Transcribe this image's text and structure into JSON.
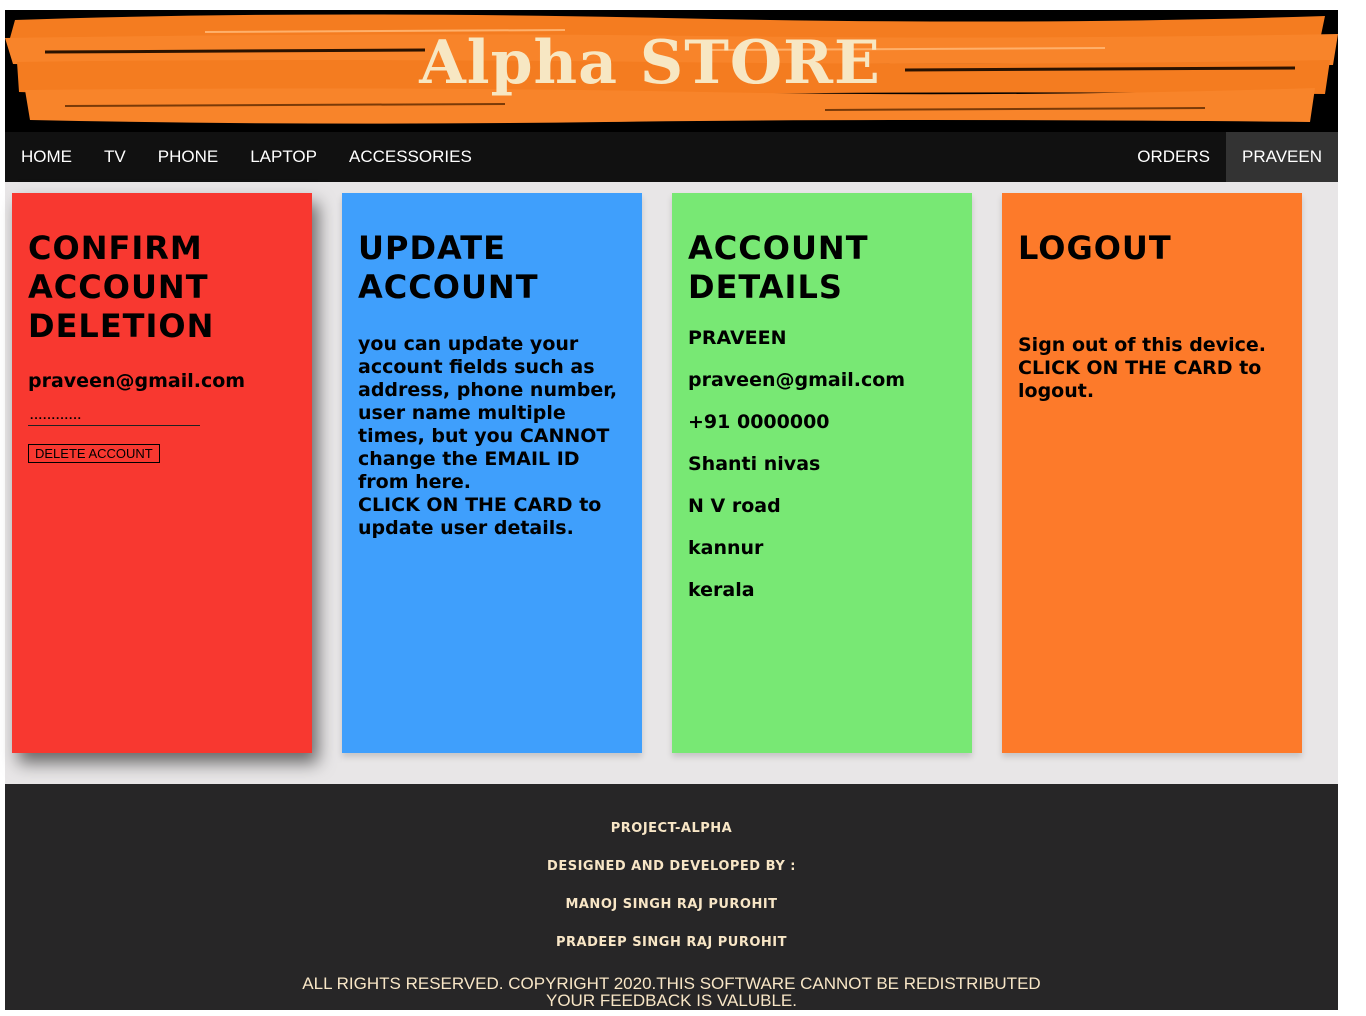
{
  "brand": {
    "title": "Alpha STORE"
  },
  "nav": {
    "items": [
      "HOME",
      "TV",
      "PHONE",
      "LAPTOP",
      "ACCESSORIES"
    ],
    "orders": "ORDERS",
    "user": "PRAVEEN"
  },
  "delete_card": {
    "title": "CONFIRM ACCOUNT DELETION",
    "email": "praveen@gmail.com",
    "password_value": "............",
    "button": "DELETE ACCOUNT",
    "color": "#f83830"
  },
  "update_card": {
    "title": "UPDATE ACCOUNT",
    "text_1": "you can update your account fields such as address, phone number, user name multiple times, but you ",
    "text_cannot": "CANNOT",
    "text_2": " change the ",
    "text_email": "EMAIL ID",
    "text_3": " from here.",
    "text_click": "CLICK ON THE CARD",
    "text_4": " to update user details.",
    "color": "#3f9ffc"
  },
  "details_card": {
    "title": "ACCOUNT DETAILS",
    "name": "PRAVEEN",
    "email": "praveen@gmail.com",
    "phone": "+91 0000000",
    "address1": "Shanti nivas",
    "address2": "N V road",
    "city": "kannur",
    "state": "kerala",
    "color": "#78e874"
  },
  "logout_card": {
    "title": "LOGOUT",
    "text_1": "Sign out of this device.",
    "text_click": "CLICK ON THE CARD",
    "text_2": " to logout.",
    "color": "#fd7a2a"
  },
  "footer": {
    "project": "PROJECT-ALPHA",
    "designed_by": "DESIGNED AND DEVELOPED BY :",
    "dev1": "MANOJ SINGH RAJ PUROHIT",
    "dev2": "PRADEEP SINGH RAJ PUROHIT",
    "copyright": "ALL RIGHTS RESERVED. COPYRIGHT 2020.THIS SOFTWARE CANNOT BE REDISTRIBUTED",
    "feedback": "YOUR FEEDBACK IS VALUBLE."
  }
}
